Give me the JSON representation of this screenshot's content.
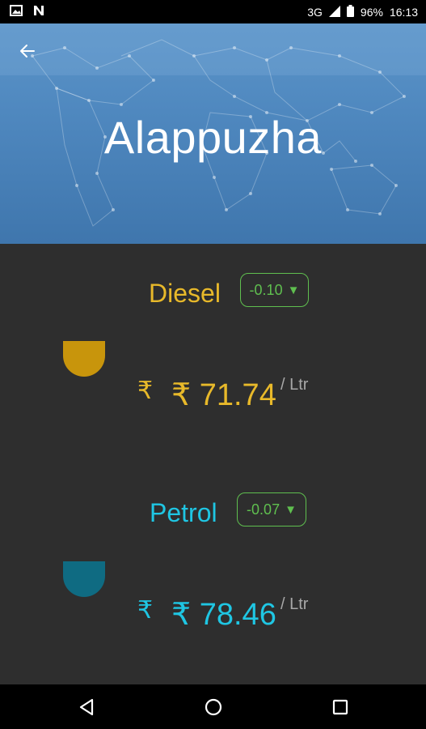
{
  "status_bar": {
    "network": "3G",
    "battery": "96%",
    "time": "16:13"
  },
  "header": {
    "city": "Alappuzha"
  },
  "fuels": [
    {
      "name": "Diesel",
      "change": "-0.10",
      "change_direction": "down",
      "currency_symbol": "₹",
      "price": "₹ 71.74",
      "unit": "/ Ltr",
      "color": "#e8b92a",
      "drop_color": "#c8950c"
    },
    {
      "name": "Petrol",
      "change": "-0.07",
      "change_direction": "down",
      "currency_symbol": "₹",
      "price": "₹ 78.46",
      "unit": "/ Ltr",
      "color": "#1fc6e3",
      "drop_color": "#0f6b82"
    }
  ],
  "colors": {
    "background": "#2e2e2e",
    "badge_green": "#5fbf4f",
    "header_blue": "#4f88bf"
  }
}
